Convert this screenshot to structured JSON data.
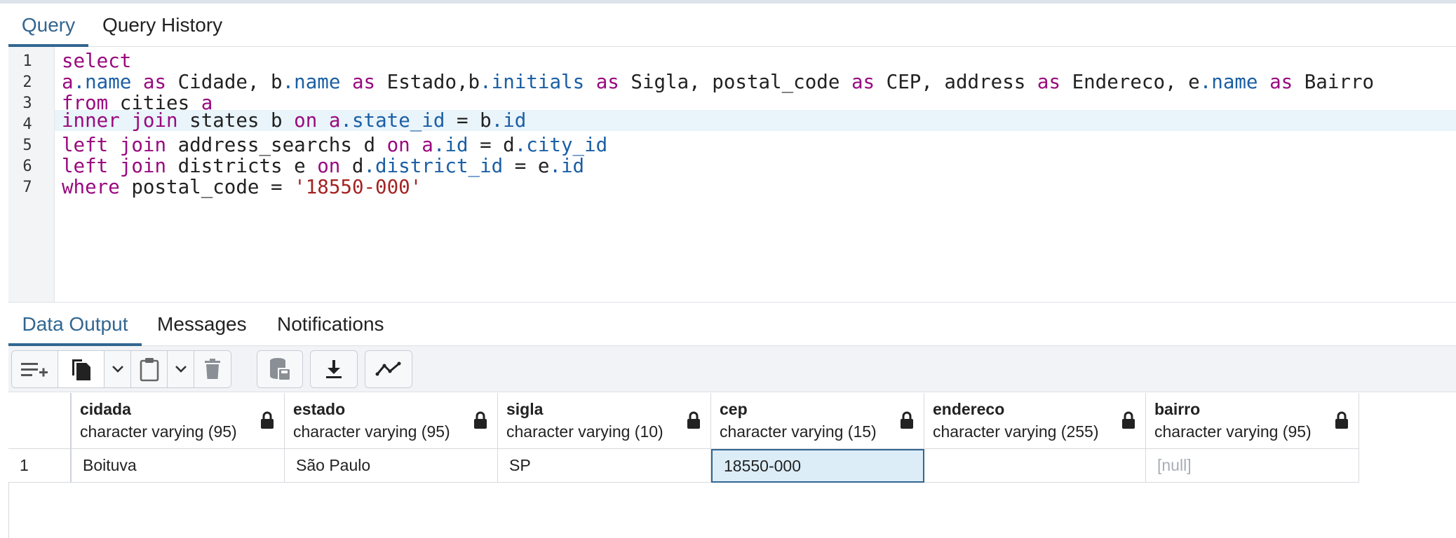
{
  "query_tabs": [
    {
      "label": "Query",
      "active": true
    },
    {
      "label": "Query History",
      "active": false
    }
  ],
  "editor": {
    "line_numbers": [
      "1",
      "2",
      "3",
      "4",
      "5",
      "6",
      "7"
    ],
    "active_line": 4,
    "lines": [
      [
        {
          "t": "select",
          "c": "kw"
        }
      ],
      [
        {
          "t": "a",
          "c": "kw"
        },
        {
          "t": ".name",
          "c": "fld"
        },
        {
          "t": " "
        },
        {
          "t": "as",
          "c": "kw"
        },
        {
          "t": " Cidade, b"
        },
        {
          "t": ".name",
          "c": "fld"
        },
        {
          "t": " "
        },
        {
          "t": "as",
          "c": "kw"
        },
        {
          "t": " Estado,b"
        },
        {
          "t": ".initials",
          "c": "fld"
        },
        {
          "t": " "
        },
        {
          "t": "as",
          "c": "kw"
        },
        {
          "t": " Sigla, postal_code "
        },
        {
          "t": "as",
          "c": "kw"
        },
        {
          "t": " CEP, address "
        },
        {
          "t": "as",
          "c": "kw"
        },
        {
          "t": " Endereco, e"
        },
        {
          "t": ".name",
          "c": "fld"
        },
        {
          "t": " "
        },
        {
          "t": "as",
          "c": "kw"
        },
        {
          "t": " Bairro"
        }
      ],
      [
        {
          "t": "from",
          "c": "kw"
        },
        {
          "t": " cities "
        },
        {
          "t": "a",
          "c": "kw"
        }
      ],
      [
        {
          "t": "inner join",
          "c": "kw"
        },
        {
          "t": " states b "
        },
        {
          "t": "on",
          "c": "kw"
        },
        {
          "t": " "
        },
        {
          "t": "a",
          "c": "kw"
        },
        {
          "t": ".state_id",
          "c": "fld"
        },
        {
          "t": " = b"
        },
        {
          "t": ".id",
          "c": "fld"
        }
      ],
      [
        {
          "t": "left join",
          "c": "kw"
        },
        {
          "t": " address_searchs d "
        },
        {
          "t": "on",
          "c": "kw"
        },
        {
          "t": " "
        },
        {
          "t": "a",
          "c": "kw"
        },
        {
          "t": ".id",
          "c": "fld"
        },
        {
          "t": " = d"
        },
        {
          "t": ".city_id",
          "c": "fld"
        }
      ],
      [
        {
          "t": "left join",
          "c": "kw"
        },
        {
          "t": " districts e "
        },
        {
          "t": "on",
          "c": "kw"
        },
        {
          "t": " d"
        },
        {
          "t": ".district_id",
          "c": "fld"
        },
        {
          "t": " = e"
        },
        {
          "t": ".id",
          "c": "fld"
        }
      ],
      [
        {
          "t": "where",
          "c": "kw"
        },
        {
          "t": " postal_code = "
        },
        {
          "t": "'18550-000'",
          "c": "str"
        }
      ]
    ]
  },
  "output_tabs": [
    {
      "label": "Data Output",
      "active": true
    },
    {
      "label": "Messages",
      "active": false
    },
    {
      "label": "Notifications",
      "active": false
    }
  ],
  "toolbar": {
    "buttons": [
      "add-row-icon",
      "copy-icon",
      "chevron-down-icon",
      "paste-icon",
      "chevron-down-icon",
      "delete-icon",
      "save-data-icon",
      "download-icon",
      "graph-icon"
    ]
  },
  "grid": {
    "columns": [
      {
        "name": "cidada",
        "type": "character varying (95)"
      },
      {
        "name": "estado",
        "type": "character varying (95)"
      },
      {
        "name": "sigla",
        "type": "character varying (10)"
      },
      {
        "name": "cep",
        "type": "character varying (15)"
      },
      {
        "name": "endereco",
        "type": "character varying (255)"
      },
      {
        "name": "bairro",
        "type": "character varying (95)"
      }
    ],
    "rows": [
      {
        "num": "1",
        "cells": [
          "Boituva",
          "São Paulo",
          "SP",
          "18550-000",
          "",
          "[null]"
        ]
      }
    ],
    "selected_cell": {
      "row": 0,
      "col": 3
    }
  },
  "colors": {
    "accent": "#326690",
    "keyword": "#990a7f",
    "field": "#1b5fa5",
    "string": "#a52323",
    "active_line": "#e9f4fb",
    "selected_cell": "#dcedf8"
  }
}
